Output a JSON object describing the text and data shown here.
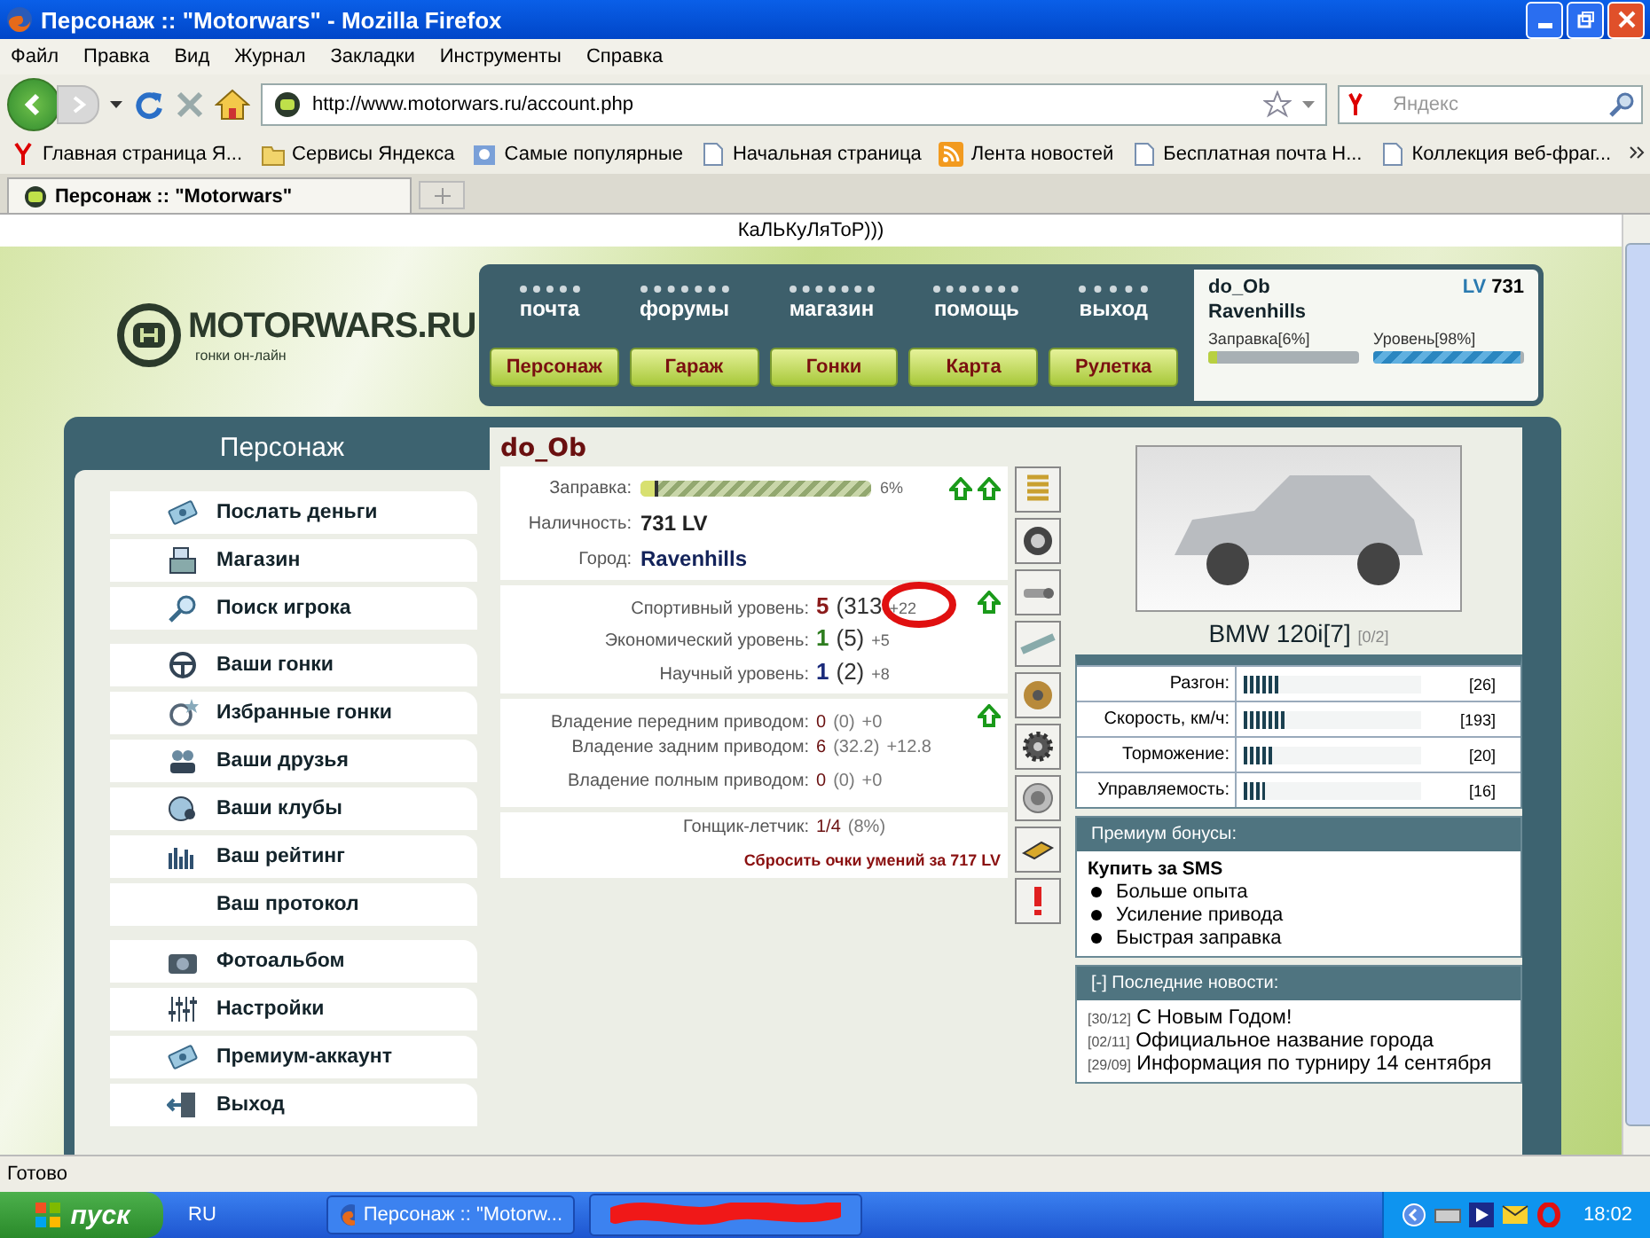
{
  "window": {
    "title": "Персонаж :: \"Motorwars\" - Mozilla Firefox"
  },
  "menu": [
    "Файл",
    "Правка",
    "Вид",
    "Журнал",
    "Закладки",
    "Инструменты",
    "Справка"
  ],
  "address": {
    "value": "http://www.motorwars.ru/account.php"
  },
  "search": {
    "placeholder": "Яндекс"
  },
  "bookmarks": [
    {
      "label": "Главная страница Я...",
      "kind": "yandex"
    },
    {
      "label": "Сервисы Яндекса",
      "kind": "folder"
    },
    {
      "label": "Самые популярные",
      "kind": "smart"
    },
    {
      "label": "Начальная страница",
      "kind": "page"
    },
    {
      "label": "Лента новостей",
      "kind": "rss"
    },
    {
      "label": "Бесплатная почта Н...",
      "kind": "page"
    },
    {
      "label": "Коллекция веб-фраг...",
      "kind": "page"
    }
  ],
  "tabs": [
    {
      "label": "Персонаж :: \"Motorwars\"",
      "selected": true
    }
  ],
  "page": {
    "top_text": "КаЛЬКуЛяТоР)))",
    "logo": {
      "name": "MOTORWARS.RU",
      "tagline": "гонки он-лайн"
    },
    "top_links": [
      "почта",
      "форумы",
      "магазин",
      "помощь",
      "выход"
    ],
    "main_nav": [
      "Персонаж",
      "Гараж",
      "Гонки",
      "Карта",
      "Рулетка"
    ],
    "user": {
      "name": "do_Ob",
      "lv_label": "LV",
      "lv": "731",
      "city": "Ravenhills",
      "fuel_label": "Заправка[6%]",
      "fuel": {
        "level": 0.06
      },
      "xp_label": "Уровень[98%]",
      "xp": {
        "level": 0.98
      }
    },
    "sidebar": {
      "title": "Персонаж",
      "groups": [
        [
          {
            "label": "Послать деньги",
            "kind": "money"
          },
          {
            "label": "Магазин",
            "kind": "shop"
          },
          {
            "label": "Поиск игрока",
            "kind": "search"
          }
        ],
        [
          {
            "label": "Ваши гонки",
            "kind": "wheel"
          },
          {
            "label": "Избранные гонки",
            "kind": "favwheel"
          },
          {
            "label": "Ваши друзья",
            "kind": "people"
          },
          {
            "label": "Ваши клубы",
            "kind": "clubs"
          },
          {
            "label": "Ваш рейтинг",
            "kind": "chart"
          },
          {
            "label": "Ваш протокол",
            "kind": "plain"
          }
        ],
        [
          {
            "label": "Фотоальбом",
            "kind": "camera"
          },
          {
            "label": "Настройки",
            "kind": "sliders"
          },
          {
            "label": "Премиум-аккаунт",
            "kind": "money"
          },
          {
            "label": "Выход",
            "kind": "door"
          }
        ]
      ]
    },
    "profile": {
      "name": "do_Ob",
      "fuel": {
        "label": "Заправка:",
        "level": 0.06,
        "reading": "6%",
        "actions": [
          {
            "kind": "up-arrow"
          },
          {
            "kind": "up-arrow"
          }
        ]
      },
      "cash": {
        "label": "Наличность:",
        "value": "731 LV"
      },
      "city": {
        "label": "Город:",
        "value": "Ravenhills"
      },
      "levels": [
        {
          "label": "Спортивный уровень:",
          "value": "5",
          "extra": "(313",
          "bonus": "+22",
          "color": "#8b1a1a",
          "upgrade": true,
          "circled": true
        },
        {
          "label": "Экономический уровень:",
          "value": "1",
          "extra": "(5)",
          "bonus": "+5",
          "color": "#2e7d1f",
          "upgrade": false,
          "circled": false
        },
        {
          "label": "Научный уровень:",
          "value": "1",
          "extra": "(2)",
          "bonus": "+8",
          "color": "#1a2a7a",
          "upgrade": false,
          "circled": false
        }
      ],
      "drives": [
        {
          "label": "Владение передним приводом:",
          "value": "0",
          "extra": "(0)",
          "bonus": "+0",
          "upgrade": true
        },
        {
          "label": "Владение задним приводом:",
          "value": "6",
          "extra": "(32.2)",
          "bonus": "+12.8",
          "upgrade": false
        },
        {
          "label": "Владение полным приводом:",
          "value": "0",
          "extra": "(0)",
          "bonus": "+0",
          "upgrade": false
        }
      ],
      "pilot": {
        "label": "Гонщик-летчик:",
        "value": "1/4",
        "extra": "(8%)"
      },
      "reset_link": "Сбросить очки умений за 717 LV"
    },
    "part_slots": [
      {
        "kind": "spring"
      },
      {
        "kind": "tire"
      },
      {
        "kind": "exhaust"
      },
      {
        "kind": "chassis"
      },
      {
        "kind": "brake"
      },
      {
        "kind": "gear"
      },
      {
        "kind": "turbo"
      },
      {
        "kind": "box"
      },
      {
        "kind": "alert"
      }
    ],
    "car": {
      "name": "BMW 120i[7]",
      "slots": "[0/2]",
      "stats": [
        {
          "label": "Разгон:",
          "level": 0.2,
          "value": "[26]"
        },
        {
          "label": "Скорость, км/ч:",
          "level": 0.24,
          "value": "[193]"
        },
        {
          "label": "Торможение:",
          "level": 0.16,
          "value": "[20]"
        },
        {
          "label": "Управляемость:",
          "level": 0.12,
          "value": "[16]"
        }
      ]
    },
    "premium": {
      "title": "Премиум бонусы:",
      "heading": "Купить за SMS",
      "items": [
        "Больше опыта",
        "Усиление привода",
        "Быстрая заправка"
      ]
    },
    "news": {
      "title": "[-] Последние новости:",
      "items": [
        {
          "date": "[30/12]",
          "text": "С Новым Годом!"
        },
        {
          "date": "[02/11]",
          "text": "Официальное название города"
        },
        {
          "date": "[29/09]",
          "text": "Информация по турниру 14 сентября"
        }
      ]
    }
  },
  "status_bar": "Готово",
  "taskbar": {
    "start": "пуск",
    "lang": "RU",
    "tasks": [
      {
        "label": "Персонаж :: \"Motorw...",
        "selected": false
      }
    ],
    "clock": "18:02"
  }
}
